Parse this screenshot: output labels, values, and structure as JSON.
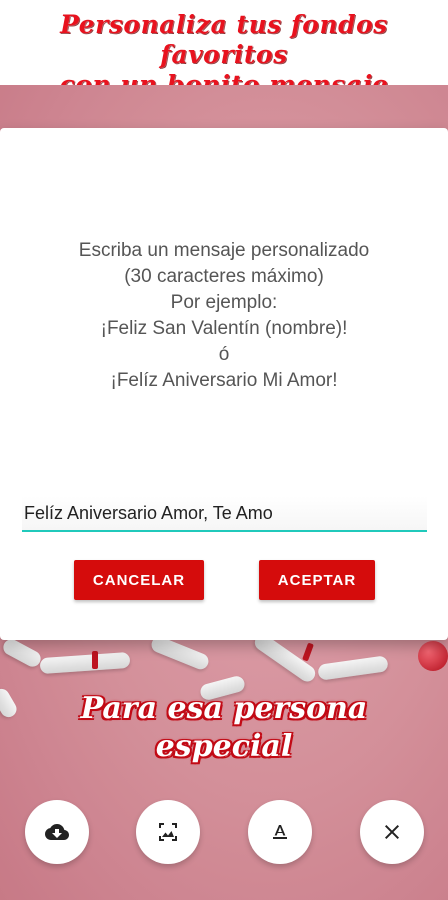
{
  "banner": {
    "line1": "Personaliza tus fondos favoritos",
    "line2": "con un bonito mensaje"
  },
  "dialog": {
    "message_lines": [
      "Escriba un mensaje personalizado",
      "(30 caracteres máximo)",
      "Por ejemplo:",
      "¡Feliz San Valentín (nombre)!",
      "ó",
      "¡Felíz Aniversario Mi Amor!"
    ],
    "input_value": "Felíz Aniversario Amor, Te Amo",
    "cancel_label": "CANCELAR",
    "accept_label": "ACEPTAR"
  },
  "wallpaper": {
    "line1": "Para esa persona",
    "line2": "especial"
  },
  "toolbar": {
    "items": [
      {
        "icon": "cloud-download-icon"
      },
      {
        "icon": "image-crop-icon"
      },
      {
        "icon": "text-format-icon"
      },
      {
        "icon": "close-icon"
      }
    ]
  },
  "colors": {
    "accent_red": "#d50c0c",
    "input_underline": "#20c9bb",
    "background_pink": "#dc95a0"
  }
}
